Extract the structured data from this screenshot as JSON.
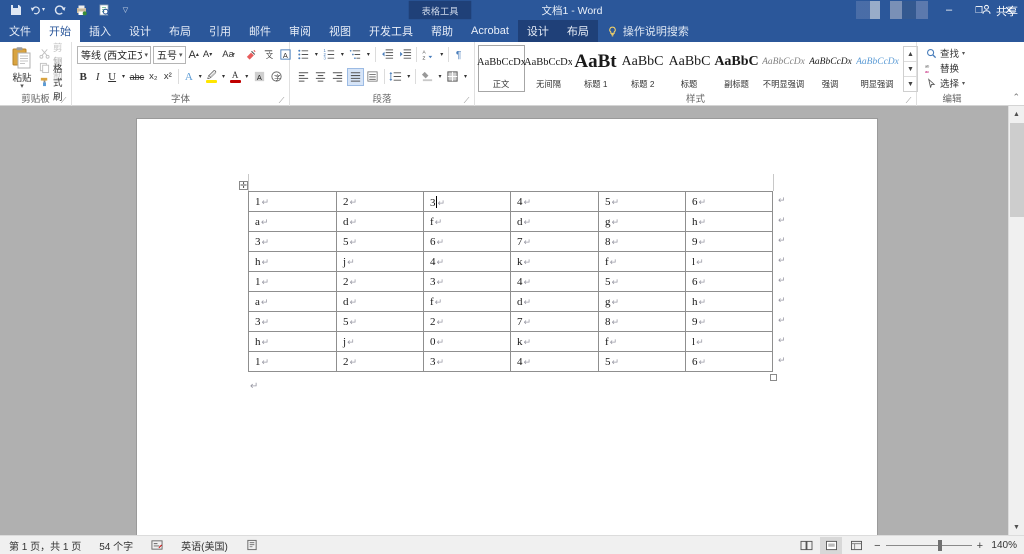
{
  "titlebar": {
    "quick_access": [
      "save-icon",
      "undo-icon",
      "redo-icon",
      "quick-print-icon",
      "print-preview-icon",
      "customize-qat-icon"
    ],
    "contextual_tools_label": "表格工具",
    "document_title": "文档1  -  Word",
    "minimize": "–",
    "restore": "❐",
    "close": "✕",
    "share_label": "共享",
    "accent": "#2b579a"
  },
  "tabs": [
    {
      "label": "文件",
      "active": false,
      "contextual": false
    },
    {
      "label": "开始",
      "active": true,
      "contextual": false
    },
    {
      "label": "插入",
      "active": false,
      "contextual": false
    },
    {
      "label": "设计",
      "active": false,
      "contextual": false
    },
    {
      "label": "布局",
      "active": false,
      "contextual": false
    },
    {
      "label": "引用",
      "active": false,
      "contextual": false
    },
    {
      "label": "邮件",
      "active": false,
      "contextual": false
    },
    {
      "label": "审阅",
      "active": false,
      "contextual": false
    },
    {
      "label": "视图",
      "active": false,
      "contextual": false
    },
    {
      "label": "开发工具",
      "active": false,
      "contextual": false
    },
    {
      "label": "帮助",
      "active": false,
      "contextual": false
    },
    {
      "label": "Acrobat",
      "active": false,
      "contextual": false
    },
    {
      "label": "设计",
      "active": false,
      "contextual": true
    },
    {
      "label": "布局",
      "active": false,
      "contextual": true
    }
  ],
  "tell_me": {
    "placeholder": "操作说明搜索"
  },
  "ribbon": {
    "clipboard": {
      "group_label": "剪贴板",
      "paste_label": "粘贴",
      "cut_label": "剪切",
      "copy_label": "复制",
      "format_painter_label": "格式刷"
    },
    "font": {
      "group_label": "字体",
      "font_name": "等线 (西文正文)",
      "font_size": "五号",
      "buttons": [
        "grow-font-icon",
        "shrink-font-icon",
        "change-case-icon",
        "clear-formatting-icon",
        "phonetic-guide-icon",
        "character-border-icon",
        "bold-icon",
        "italic-icon",
        "underline-icon",
        "strikethrough-icon",
        "subscript-icon",
        "superscript-icon",
        "text-effects-icon",
        "text-highlight-icon",
        "font-color-icon",
        "character-shading-icon",
        "enclose-characters-icon"
      ],
      "bold": "B",
      "italic": "I",
      "underline": "U",
      "strikethrough": "abc",
      "subscript": "x₂",
      "superscript": "x²"
    },
    "paragraph": {
      "group_label": "段落",
      "buttons": [
        "bullets-icon",
        "numbering-icon",
        "multilevel-list-icon",
        "decrease-indent-icon",
        "increase-indent-icon",
        "sort-icon",
        "show-marks-icon",
        "align-left-icon",
        "align-center-icon",
        "align-right-icon",
        "justify-icon",
        "distribute-icon",
        "line-spacing-icon",
        "shading-icon",
        "borders-icon"
      ]
    },
    "styles": {
      "group_label": "样式",
      "items": [
        {
          "preview": "AaBbCcDx",
          "name": "正文",
          "selected": true,
          "pilcrow": true
        },
        {
          "preview": "AaBbCcDx",
          "name": "无间隔",
          "selected": false,
          "pilcrow": true
        },
        {
          "preview": "AaBt",
          "name": "标题 1",
          "selected": false,
          "pilcrow": false
        },
        {
          "preview": "AaBbC",
          "name": "标题 2",
          "selected": false,
          "pilcrow": false
        },
        {
          "preview": "AaBbC",
          "name": "标题",
          "selected": false,
          "pilcrow": false
        },
        {
          "preview": "AaBbC",
          "name": "副标题",
          "selected": false,
          "pilcrow": false
        },
        {
          "preview": "AaBbCcDx",
          "name": "不明显强调",
          "selected": false,
          "pilcrow": false
        },
        {
          "preview": "AaBbCcDx",
          "name": "强调",
          "selected": false,
          "pilcrow": false
        },
        {
          "preview": "AaBbCcDx",
          "name": "明显强调",
          "selected": false,
          "pilcrow": false
        }
      ]
    },
    "editing": {
      "group_label": "编辑",
      "find_label": "查找",
      "replace_label": "替换",
      "select_label": "选择"
    }
  },
  "document": {
    "table": {
      "columns": 6,
      "rows": [
        [
          "1",
          "2",
          "3",
          "4",
          "5",
          "6"
        ],
        [
          "a",
          "d",
          "f",
          "d",
          "g",
          "h"
        ],
        [
          "3",
          "5",
          "6",
          "7",
          "8",
          "9"
        ],
        [
          "h",
          "j",
          "4",
          "k",
          "f",
          "l"
        ],
        [
          "1",
          "2",
          "3",
          "4",
          "5",
          "6"
        ],
        [
          "a",
          "d",
          "f",
          "d",
          "g",
          "h"
        ],
        [
          "3",
          "5",
          "2",
          "7",
          "8",
          "9"
        ],
        [
          "h",
          "j",
          "0",
          "k",
          "f",
          "l"
        ],
        [
          "1",
          "2",
          "3",
          "4",
          "5",
          "6"
        ]
      ],
      "cursor_row": 0,
      "cursor_col": 2,
      "paragraph_mark": "↵"
    },
    "trailing_paragraph_mark": "↵"
  },
  "statusbar": {
    "page_info": "第 1 页，共 1 页",
    "word_count": "54 个字",
    "language": "英语(美国)",
    "proofing_icon": "proofing-errors-icon",
    "views": [
      {
        "name": "read-mode-view",
        "glyph": "▤",
        "active": false
      },
      {
        "name": "print-layout-view",
        "glyph": "▣",
        "active": true
      },
      {
        "name": "web-layout-view",
        "glyph": "▦",
        "active": false
      }
    ],
    "zoom_out": "−",
    "zoom_in": "+",
    "zoom_value": "140%"
  }
}
